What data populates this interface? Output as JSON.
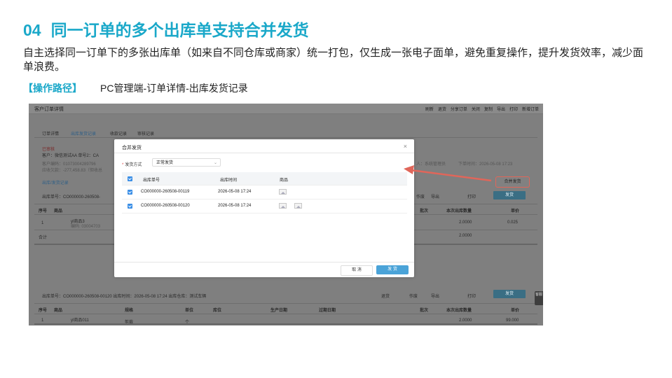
{
  "slide": {
    "number": "04",
    "title": "同一订单的多个出库单支持合并发货",
    "description": "自主选择同一订单下的多张出库单（如来自不同仓库或商家）统一打包，仅生成一张电子面单，避免重复操作，提升发货效率，减少面单浪费。",
    "path_tag": "【操作路径】",
    "path_text": "PC管理端-订单详情-出库发货记录"
  },
  "app": {
    "window_title": "客户订单详情",
    "toolbar": [
      "刷新",
      "退货",
      "分享订单",
      "关闭",
      "复制",
      "导出",
      "打印",
      "新增订单"
    ],
    "tabs": [
      "订单详情",
      "出库发货记录",
      "收款记录",
      "审核记录"
    ],
    "status": "已审核",
    "customer_line": "客户：微信测试AA   单号2：CA",
    "customer_code": "客户编码：01073004289796",
    "balance": "应收欠款：-277,458.83（但收总",
    "creator": "人：系统管理员",
    "order_time": "下单时间：2026-05-08 17:23",
    "record_link": "出库/发货记录",
    "outbound_no_1": "出库单号：CO000000-260508-",
    "table_headers": [
      "序号",
      "商品",
      "批次",
      "本次出库数量",
      "单价"
    ],
    "row1": {
      "index": "1",
      "product": "yl商品3",
      "code": "编码: 03004703",
      "qty": "2.0000",
      "price": "0.025"
    },
    "total_label": "合计",
    "total_qty": "2.0000",
    "merge_button": "合并发货",
    "ship_button": "发货",
    "actions": [
      "作废",
      "导出",
      "打印"
    ],
    "outbound_info_2": "出库单号：CO000000-260508-00120   出库时间：2026-05-08 17:24   出库仓库：测试车辆",
    "table2_headers": [
      "序号",
      "商品",
      "规格",
      "单位",
      "库位",
      "生产日期",
      "过期日期",
      "批次",
      "本次出库数量",
      "单价"
    ],
    "row2": {
      "index": "1",
      "product": "yl商品011",
      "spec": "剪裁",
      "unit": "个",
      "qty": "2.0000",
      "price": "99.000"
    },
    "side_tab": "客服"
  },
  "modal": {
    "title": "合并发货",
    "method_label": "发货方式",
    "method_value": "正常发货",
    "headers": [
      "出库单号",
      "出库时间",
      "商品"
    ],
    "rows": [
      {
        "no": "CO000000-260508-00119",
        "time": "2026-05-08 17:24",
        "images": 1
      },
      {
        "no": "CO000000-260508-00120",
        "time": "2026-05-08 17:24",
        "images": 2
      }
    ],
    "cancel": "取 消",
    "confirm": "发 货"
  },
  "colors": {
    "accent": "#1aa8c9",
    "highlight": "#e0665a",
    "primary_button": "#4aa3d8"
  }
}
